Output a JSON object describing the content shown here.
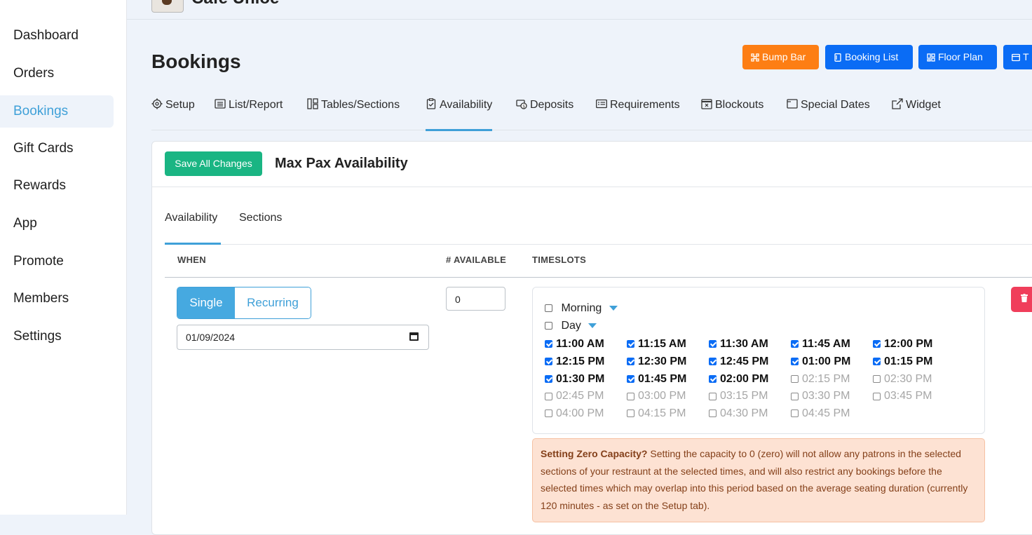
{
  "sidebar": {
    "items": [
      {
        "label": "Dashboard"
      },
      {
        "label": "Orders"
      },
      {
        "label": "Bookings",
        "active": true
      },
      {
        "label": "Gift Cards"
      },
      {
        "label": "Rewards"
      },
      {
        "label": "App"
      },
      {
        "label": "Promote"
      },
      {
        "label": "Members"
      },
      {
        "label": "Settings"
      }
    ]
  },
  "header": {
    "venue": "Cafe Unloe",
    "dots": "···"
  },
  "page": {
    "title": "Bookings"
  },
  "toolbar": {
    "bump_bar": "Bump Bar",
    "booking_list": "Booking List",
    "floor_plan": "Floor Plan",
    "truncated": "T"
  },
  "tabs": [
    "Setup",
    "List/Report",
    "Tables/Sections",
    "Availability",
    "Deposits",
    "Requirements",
    "Blockouts",
    "Special Dates",
    "Widget"
  ],
  "active_tab": "Availability",
  "card": {
    "save_label": "Save All Changes",
    "title": "Max Pax Availability"
  },
  "subtabs": {
    "availability": "Availability",
    "sections": "Sections"
  },
  "table": {
    "when": "WHEN",
    "available": "# AVAILABLE",
    "timeslots": "TIMESLOTS"
  },
  "row": {
    "mode_single": "Single",
    "mode_recurring": "Recurring",
    "date": "01/09/2024",
    "available": "0",
    "groups": {
      "morning": "Morning",
      "day": "Day"
    }
  },
  "slots": [
    {
      "time": "11:00 AM",
      "checked": true
    },
    {
      "time": "11:15 AM",
      "checked": true
    },
    {
      "time": "11:30 AM",
      "checked": true
    },
    {
      "time": "11:45 AM",
      "checked": true
    },
    {
      "time": "12:00 PM",
      "checked": true
    },
    {
      "time": "12:15 PM",
      "checked": true
    },
    {
      "time": "12:30 PM",
      "checked": true
    },
    {
      "time": "12:45 PM",
      "checked": true
    },
    {
      "time": "01:00 PM",
      "checked": true
    },
    {
      "time": "01:15 PM",
      "checked": true
    },
    {
      "time": "01:30 PM",
      "checked": true
    },
    {
      "time": "01:45 PM",
      "checked": true
    },
    {
      "time": "02:00 PM",
      "checked": true
    },
    {
      "time": "02:15 PM",
      "checked": false
    },
    {
      "time": "02:30 PM",
      "checked": false
    },
    {
      "time": "02:45 PM",
      "checked": false
    },
    {
      "time": "03:00 PM",
      "checked": false
    },
    {
      "time": "03:15 PM",
      "checked": false
    },
    {
      "time": "03:30 PM",
      "checked": false
    },
    {
      "time": "03:45 PM",
      "checked": false
    },
    {
      "time": "04:00 PM",
      "checked": false
    },
    {
      "time": "04:15 PM",
      "checked": false
    },
    {
      "time": "04:30 PM",
      "checked": false
    },
    {
      "time": "04:45 PM",
      "checked": false
    }
  ],
  "alert": {
    "title": "Setting Zero Capacity?",
    "body": "Setting the capacity to 0 (zero) will not allow any patrons in the selected sections of your restraunt at the selected times, and will also restrict any bookings before the selected times which may overlap into this period based on the average seating duration (currently 120 minutes - as set on the Setup tab)."
  },
  "colors": {
    "accent": "#3fa0d8",
    "primary": "#0a6cf5",
    "success": "#1ab583",
    "warning": "#fd7e14",
    "danger": "#f03e5b"
  }
}
